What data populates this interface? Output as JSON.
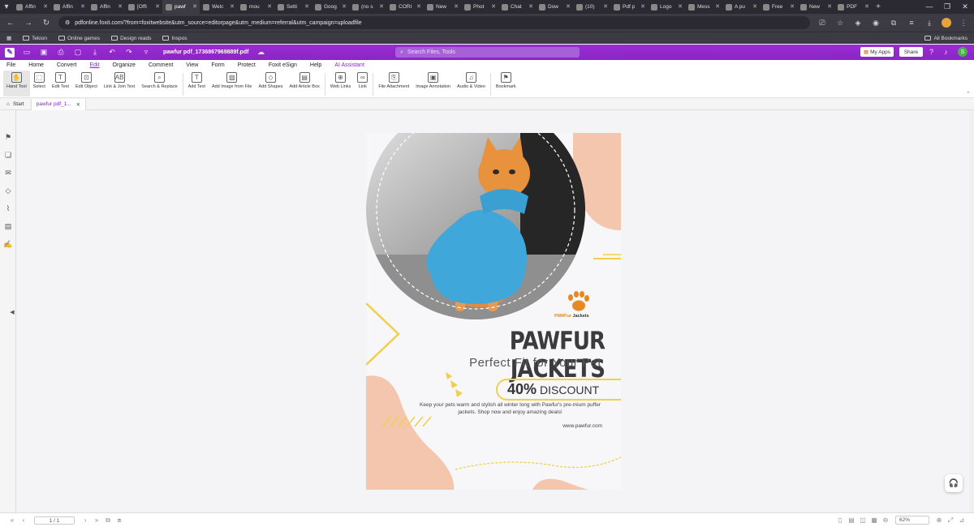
{
  "browser": {
    "tabs": [
      {
        "label": "Affin",
        "icon": "affinity-icon"
      },
      {
        "label": "Affin",
        "icon": "affinity-icon"
      },
      {
        "label": "Affin",
        "icon": "affinity-icon"
      },
      {
        "label": "[Offi",
        "icon": "globe-icon"
      },
      {
        "label": "pawf",
        "icon": "foxit-icon",
        "active": true
      },
      {
        "label": "Welc",
        "icon": "word-icon"
      },
      {
        "label": "mou",
        "icon": "globe-icon"
      },
      {
        "label": "Setti",
        "icon": "gear-icon"
      },
      {
        "label": "Goog",
        "icon": "google-icon"
      },
      {
        "label": "(no s",
        "icon": "gmail-icon"
      },
      {
        "label": "CORI",
        "icon": "linkedin-icon"
      },
      {
        "label": "New",
        "icon": "globe-icon"
      },
      {
        "label": "Phot",
        "icon": "picsart-icon"
      },
      {
        "label": "Chat",
        "icon": "chatgpt-icon"
      },
      {
        "label": "Dow",
        "icon": "download-icon"
      },
      {
        "label": "(10) ",
        "icon": "youtube-icon"
      },
      {
        "label": "Pdf p",
        "icon": "word-icon"
      },
      {
        "label": "Logo",
        "icon": "canva-icon"
      },
      {
        "label": "Mess",
        "icon": "envato-icon"
      },
      {
        "label": "A pu",
        "icon": "canva-icon"
      },
      {
        "label": "Free",
        "icon": "word-icon"
      },
      {
        "label": "New",
        "icon": "globe-icon"
      },
      {
        "label": "PDF",
        "icon": "pdf-icon"
      }
    ],
    "url": "pdfonline.foxit.com/?from=foxitwebsite&utm_source=editorpage&utm_medium=referral&utm_campaign=uploadfile",
    "bookmarks": [
      "Tekion",
      "Online games",
      "Design reads",
      "Inspos"
    ],
    "all_bookmarks": "All Bookmarks"
  },
  "foxit": {
    "doc_name": "pawfur pdf_1736867969889f.pdf",
    "search_placeholder": "Search Files, Tools",
    "my_apps": "My Apps",
    "share": "Share",
    "user_initial": "S",
    "menus": [
      "File",
      "Home",
      "Convert",
      "Edit",
      "Organize",
      "Comment",
      "View",
      "Form",
      "Protect",
      "Foxit eSign",
      "Help",
      "AI Assistant"
    ],
    "active_menu": "Edit",
    "ribbon": [
      {
        "label": "Hand Tool",
        "icon": "hand-icon",
        "selected": true
      },
      {
        "label": "Select",
        "icon": "cursor-icon"
      },
      {
        "label": "Edit Text",
        "icon": "edit-text-icon"
      },
      {
        "label": "Edit Object",
        "icon": "edit-object-icon"
      },
      {
        "label": "Link & Join Text",
        "icon": "link-join-icon"
      },
      {
        "label": "Search & Replace",
        "icon": "search-replace-icon"
      },
      {
        "label": "Add Text",
        "icon": "add-text-icon"
      },
      {
        "label": "Add Image from File",
        "icon": "image-icon"
      },
      {
        "label": "Add Shapes",
        "icon": "shapes-icon"
      },
      {
        "label": "Add Article Box",
        "icon": "article-icon"
      },
      {
        "label": "Web Links",
        "icon": "web-links-icon"
      },
      {
        "label": "Link",
        "icon": "link-icon"
      },
      {
        "label": "File Attachment",
        "icon": "attachment-icon"
      },
      {
        "label": "Image Annotation",
        "icon": "image-annotation-icon"
      },
      {
        "label": "Audio & Video",
        "icon": "audio-video-icon"
      },
      {
        "label": "Bookmark",
        "icon": "bookmark-icon"
      }
    ],
    "start_tab": "Start",
    "doc_tab": "pawfur pdf_1...",
    "page_indicator": "1 / 1",
    "zoom": "62%"
  },
  "flyer": {
    "title": "PAWFUR JACKETS",
    "subtitle": "Perfect Fit for Your Pet",
    "discount_pct": "40%",
    "discount_label": "DISCOUNT",
    "body": "Keep your pets warm and stylish all winter long with Pawfur's pre-mium puffer jackets. Shop now and enjoy amazing deals!",
    "website": "www.pawfur.com",
    "brand_a": "PAWFur",
    "brand_b": " Jackets",
    "colors": {
      "peach": "#f4c6ae",
      "yellow": "#f0d04a",
      "orange": "#e58a20",
      "jacket": "#3fa7d9"
    }
  }
}
